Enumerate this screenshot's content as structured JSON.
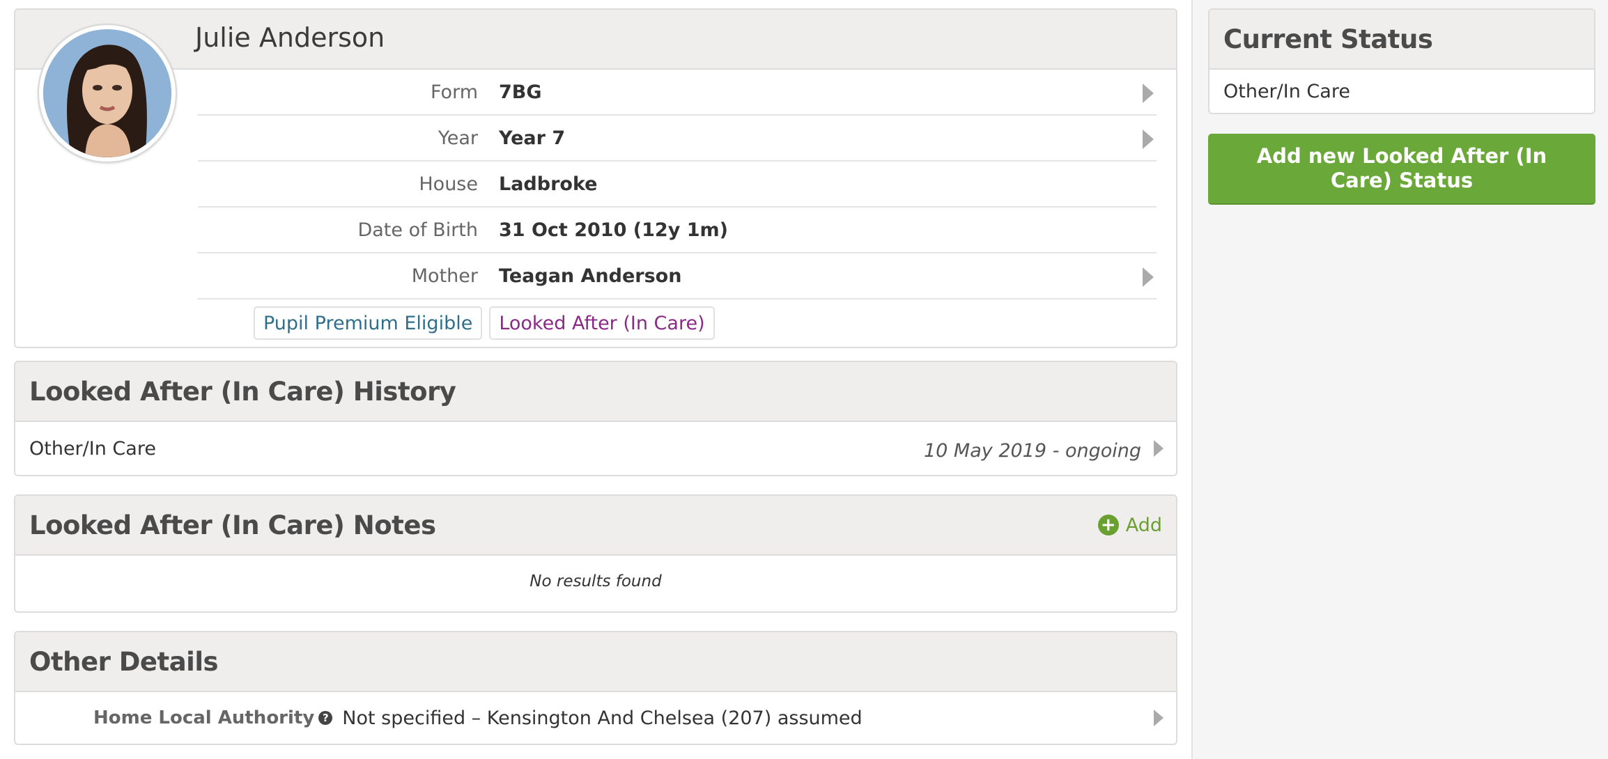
{
  "profile": {
    "name": "Julie Anderson",
    "fields": [
      {
        "label": "Form",
        "value": "7BG"
      },
      {
        "label": "Year",
        "value": "Year 7"
      },
      {
        "label": "House",
        "value": "Ladbroke"
      },
      {
        "label": "Date of Birth",
        "value": "31 Oct 2010 (12y 1m)"
      },
      {
        "label": "Mother",
        "value": "Teagan Anderson"
      }
    ],
    "tags": [
      "Pupil Premium Eligible",
      "Looked After (In Care)"
    ],
    "tag_colors": {
      "pupil_premium": "#2f6f8c",
      "looked_after": "#8a2a86"
    }
  },
  "history": {
    "title": "Looked After (In Care) History",
    "rows": [
      {
        "status": "Other/In Care",
        "period": "10 May 2019 - ongoing"
      }
    ]
  },
  "notes": {
    "title": "Looked After (In Care) Notes",
    "add_label": "Add",
    "empty_text": "No results found"
  },
  "other": {
    "title": "Other Details",
    "label": "Home Local Authority",
    "value": "Not specified – Kensington And Chelsea (207) assumed"
  },
  "side": {
    "status_title": "Current Status",
    "status_value": "Other/In Care",
    "button_label": "Add new Looked After (In Care) Status",
    "accent": "#6aa83a"
  }
}
